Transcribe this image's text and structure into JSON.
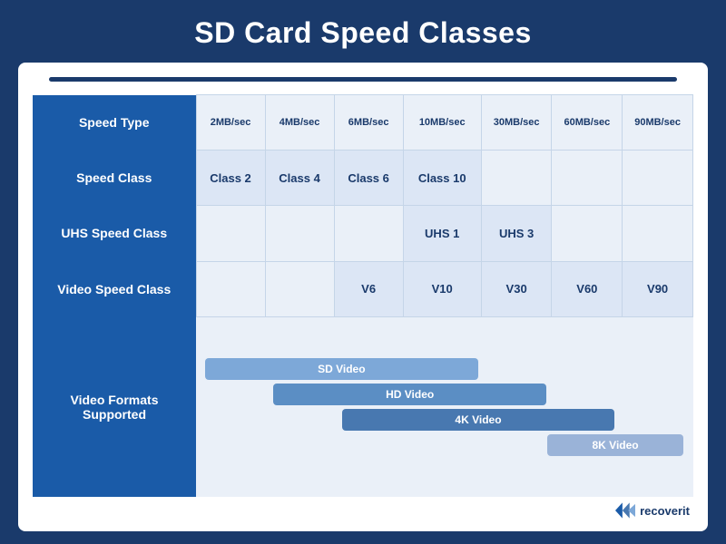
{
  "title": "SD Card Speed Classes",
  "topbar": {},
  "table": {
    "rows": [
      {
        "label": "Speed Type",
        "cells": [
          "2MB/sec",
          "4MB/sec",
          "6MB/sec",
          "10MB/sec",
          "30MB/sec",
          "60MB/sec",
          "90MB/sec"
        ]
      },
      {
        "label": "Speed Class",
        "cells": [
          "Class 2",
          "Class 4",
          "Class 6",
          "Class 10",
          "",
          "",
          ""
        ]
      },
      {
        "label": "UHS Speed Class",
        "cells": [
          "",
          "",
          "",
          "UHS 1",
          "UHS 3",
          "",
          ""
        ]
      },
      {
        "label": "Video Speed Class",
        "cells": [
          "",
          "",
          "V6",
          "V10",
          "V30",
          "V60",
          "V90"
        ]
      }
    ],
    "video_formats_label": "Video Formats\nSupported",
    "video_formats": [
      {
        "label": "SD Video",
        "start": 1,
        "span": 4,
        "class": "bar-sd"
      },
      {
        "label": "HD Video",
        "start": 2,
        "span": 4,
        "class": "bar-hd"
      },
      {
        "label": "4K Video",
        "start": 3,
        "span": 4,
        "class": "bar-4k"
      },
      {
        "label": "8K Video",
        "start": 5,
        "span": 2,
        "class": "bar-8k"
      }
    ]
  },
  "logo": {
    "brand": "recoverit"
  }
}
